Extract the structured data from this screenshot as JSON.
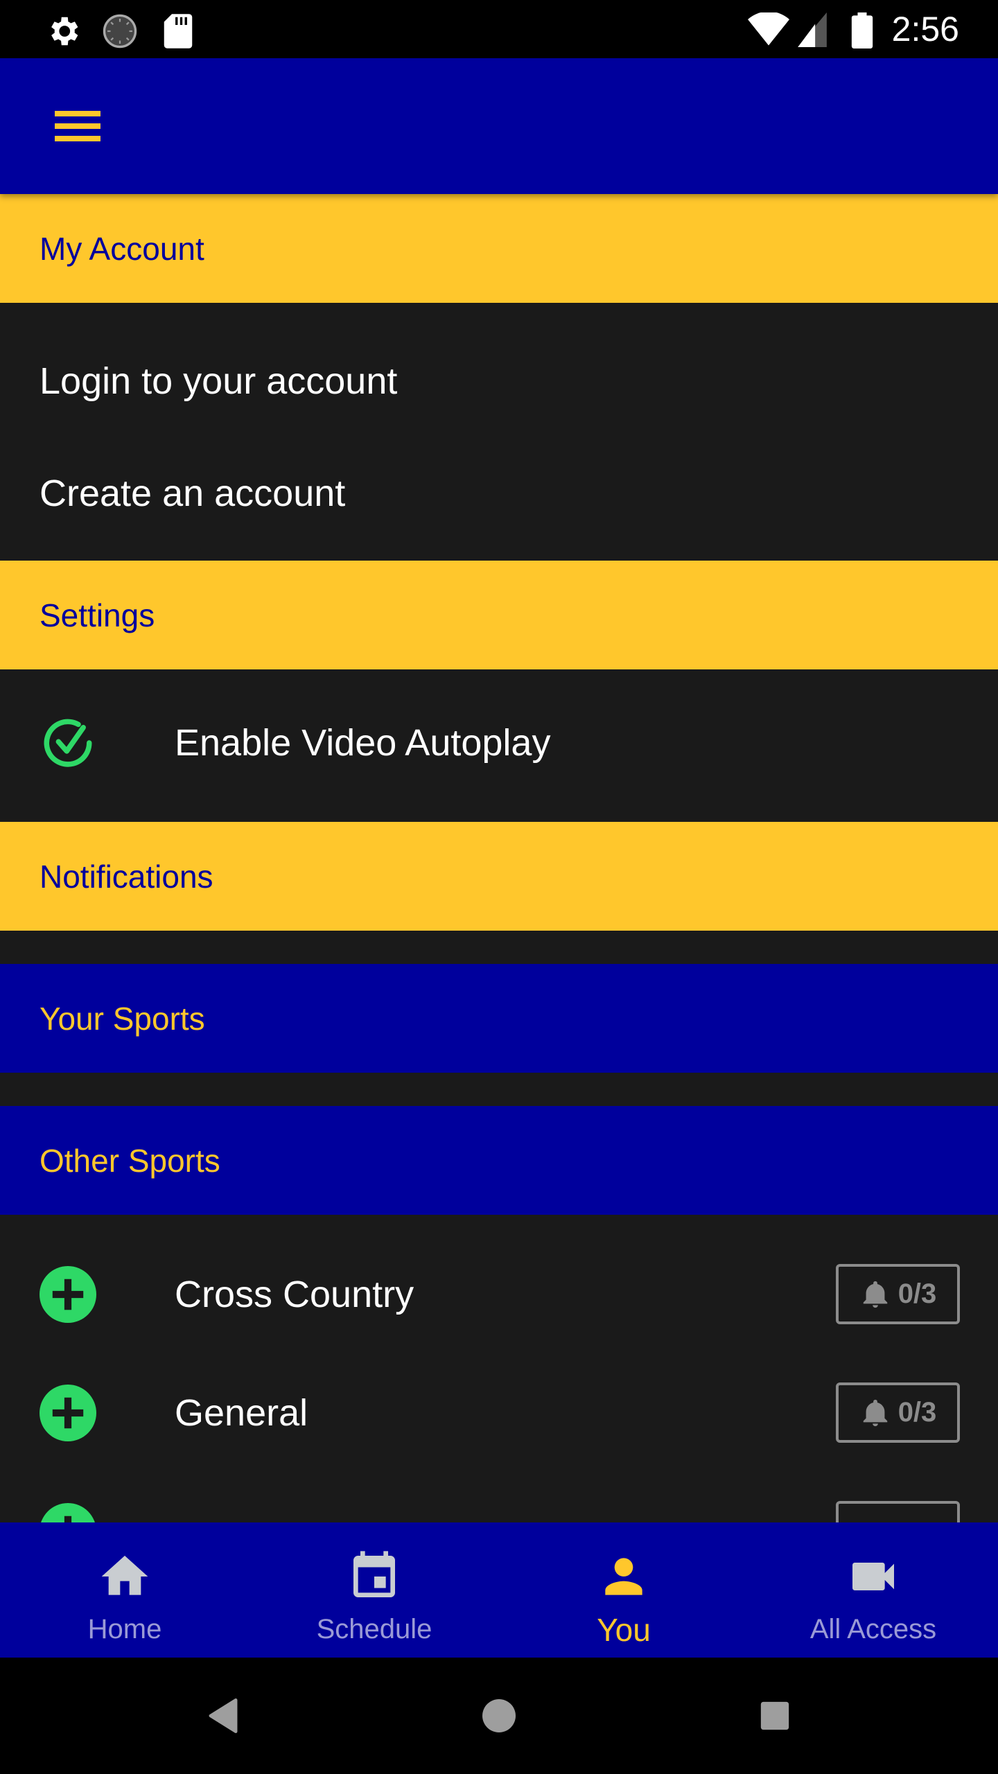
{
  "status_bar": {
    "time": "2:56",
    "left_icons": [
      "settings-icon",
      "sync-icon",
      "sd-card-icon"
    ],
    "right_icons": [
      "wifi-icon",
      "signal-icon",
      "battery-icon"
    ]
  },
  "app_bar": {
    "menu_icon": "hamburger-menu-icon"
  },
  "sections": {
    "my_account": {
      "title": "My Account",
      "items": [
        "Login to your account",
        "Create an account"
      ]
    },
    "settings": {
      "title": "Settings",
      "items": [
        {
          "label": "Enable Video Autoplay",
          "icon": "check-circle-icon",
          "checked": true
        }
      ]
    },
    "notifications": {
      "title": "Notifications"
    },
    "your_sports": {
      "title": "Your Sports",
      "items": []
    },
    "other_sports": {
      "title": "Other Sports",
      "items": [
        {
          "label": "Cross Country",
          "icon": "add-circle-icon",
          "notifications": "0/3"
        },
        {
          "label": "General",
          "icon": "add-circle-icon",
          "notifications": "0/3"
        },
        {
          "label": "",
          "icon": "add-circle-icon",
          "notifications": ""
        }
      ]
    }
  },
  "bottom_nav": {
    "items": [
      {
        "label": "Home",
        "icon": "home-icon",
        "active": false
      },
      {
        "label": "Schedule",
        "icon": "calendar-icon",
        "active": false
      },
      {
        "label": "You",
        "icon": "person-icon",
        "active": true
      },
      {
        "label": "All Access",
        "icon": "video-camera-icon",
        "active": false
      }
    ]
  },
  "system_nav": {
    "buttons": [
      "back-icon",
      "home-circle-icon",
      "recents-icon"
    ]
  },
  "colors": {
    "primary_blue": "#00009c",
    "accent_yellow": "#ffc72c",
    "background": "#1a1a1a",
    "success_green": "#2ed866",
    "muted_gray": "#8c8c8c",
    "nav_inactive": "#9a9ad6"
  }
}
